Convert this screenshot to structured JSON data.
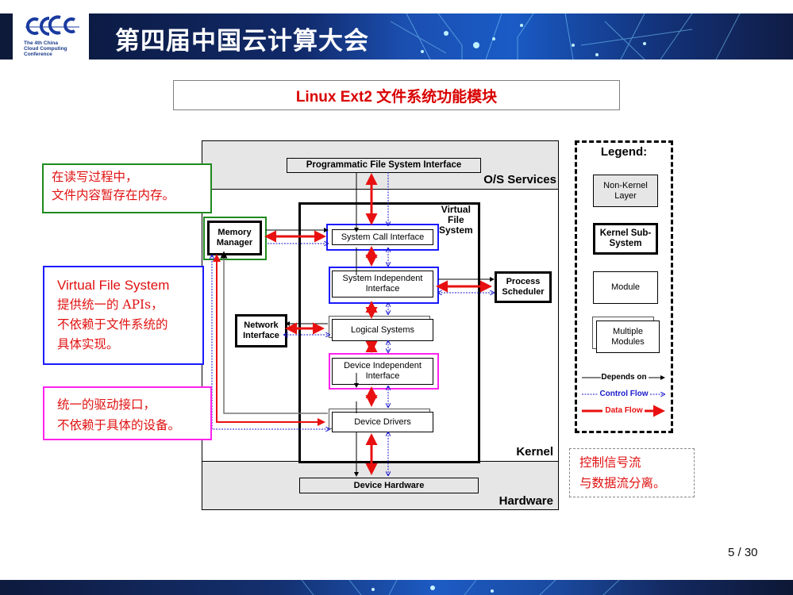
{
  "header": {
    "logo_mark": "CCCC",
    "logo_lines": [
      "The 4th China",
      "Cloud Computing",
      "Conference"
    ],
    "banner_title": "第四届中国云计算大会"
  },
  "slide": {
    "title": "Linux Ext2 文件系统功能模块",
    "page": "5 / 30"
  },
  "diagram": {
    "layers": {
      "os_services": "O/S Services",
      "kernel": "Kernel",
      "hardware": "Hardware"
    },
    "vfs_label": [
      "Virtual",
      "File",
      "System"
    ],
    "boxes": {
      "programmatic_fs_interface": "Programmatic File System Interface",
      "memory_manager": [
        "Memory",
        "Manager"
      ],
      "system_call_interface": "System Call Interface",
      "system_independent_interface": [
        "System Independent",
        "Interface"
      ],
      "process_scheduler": [
        "Process",
        "Scheduler"
      ],
      "network_interface": [
        "Network",
        "Interface"
      ],
      "logical_systems": "Logical Systems",
      "device_independent_interface": [
        "Device Independent",
        "Interface"
      ],
      "device_drivers": "Device Drivers",
      "device_hardware": "Device Hardware"
    }
  },
  "legend": {
    "title": "Legend:",
    "non_kernel": [
      "Non-Kernel",
      "Layer"
    ],
    "kernel_sub": [
      "Kernel Sub-",
      "System"
    ],
    "module": "Module",
    "multiple_modules": [
      "Multiple",
      "Modules"
    ],
    "depends_on": "Depends on",
    "control_flow": "Control Flow",
    "data_flow": "Data Flow",
    "colors": {
      "depends_on": "#000000",
      "control_flow": "#1a1acc",
      "data_flow": "#e81010"
    }
  },
  "notes": {
    "memory": [
      "在读写过程中，",
      "文件内容暂存在内存。"
    ],
    "vfs": [
      "Virtual File System",
      "提供统一的 APIs，",
      "不依赖于文件系统的",
      "具体实现。"
    ],
    "driver": [
      "统一的驱动接口，",
      "不依赖于具体的设备。"
    ],
    "flow": [
      "控制信号流",
      "与数据流分离。"
    ]
  }
}
